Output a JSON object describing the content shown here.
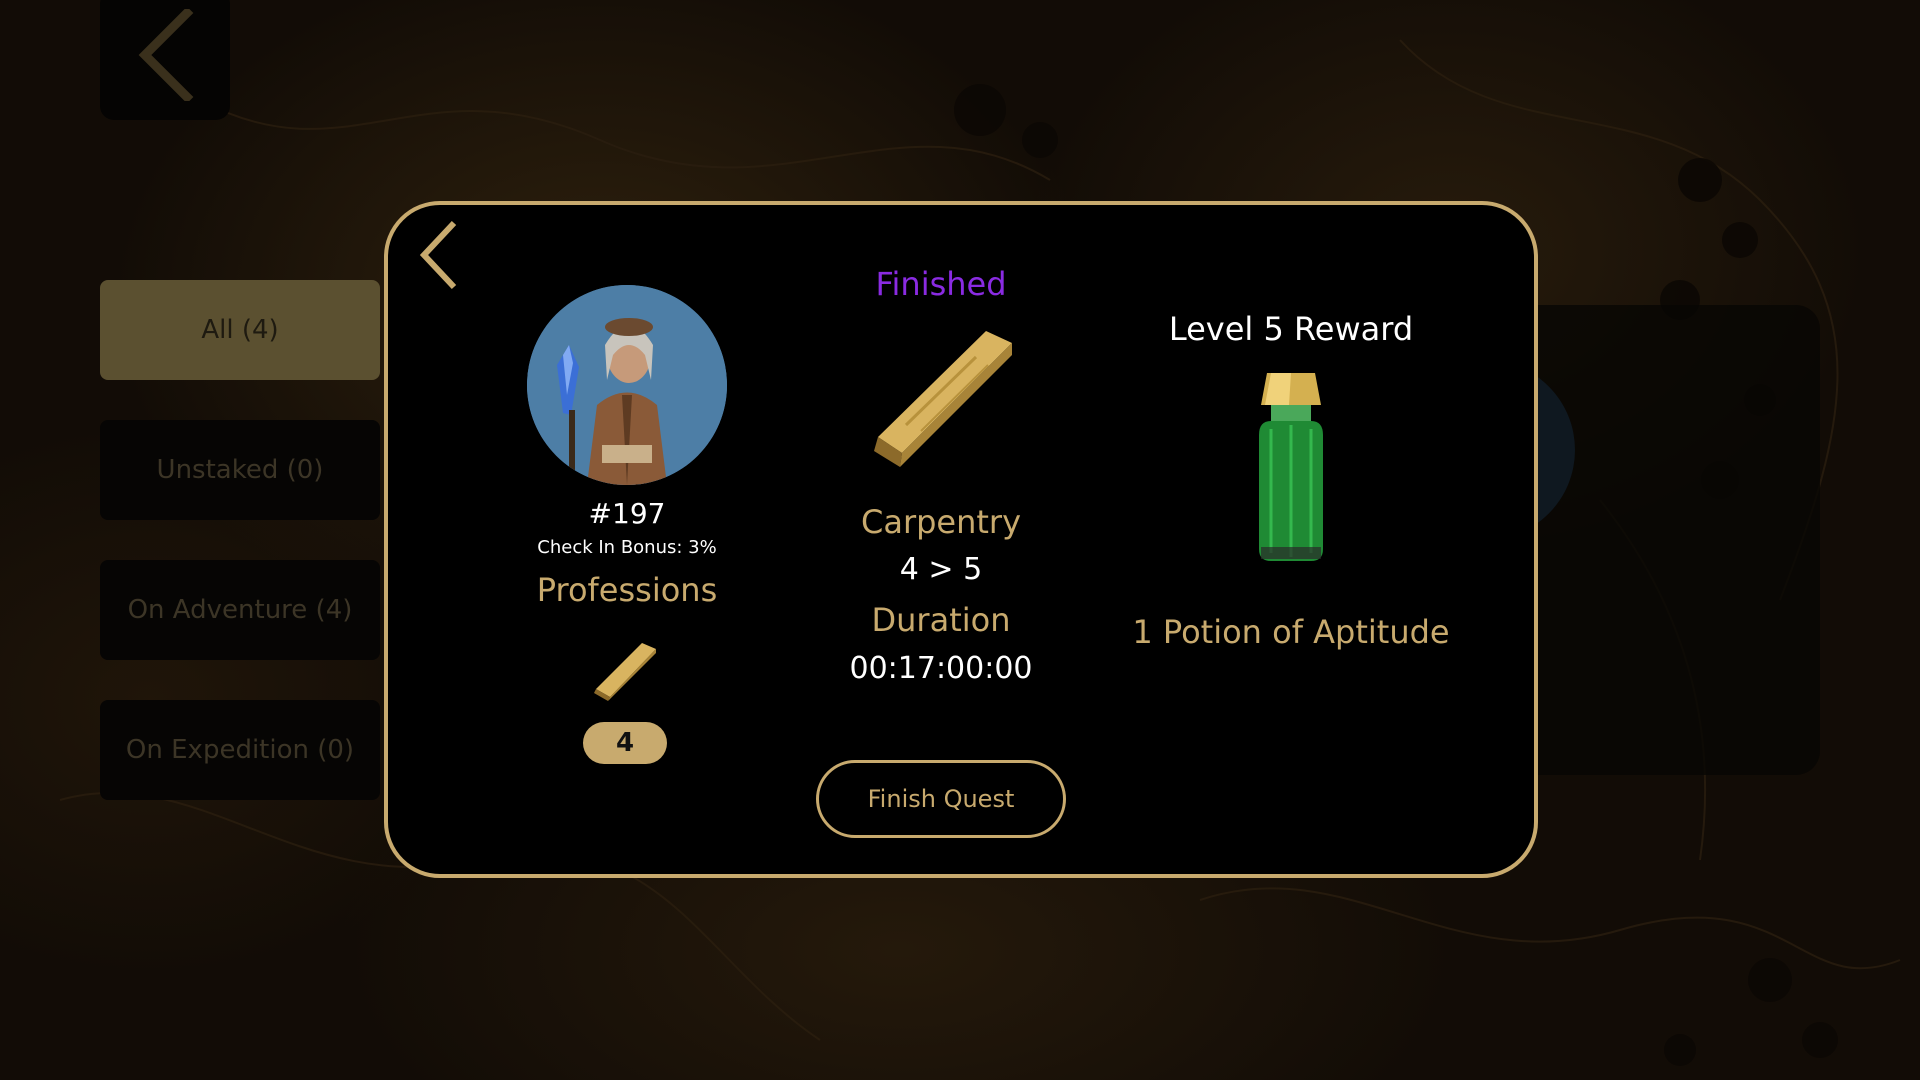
{
  "filters": {
    "all": "All (4)",
    "unstaked": "Unstaked (0)",
    "on_adventure": "On Adventure (4)",
    "on_expedition": "On Expedition (0)"
  },
  "hero": {
    "id": "#197",
    "check_in_bonus": "Check In Bonus: 3%",
    "professions_label": "Professions",
    "profession_level": "4"
  },
  "quest": {
    "status": "Finished",
    "profession": "Carpentry",
    "level_change": "4 > 5",
    "duration_label": "Duration",
    "duration": "00:17:00:00",
    "finish_label": "Finish Quest"
  },
  "reward": {
    "title": "Level 5 Reward",
    "item": "1 Potion of Aptitude"
  },
  "colors": {
    "gold": "#c8aa6e",
    "status_purple": "#8a2be2",
    "active_filter": "#5b5030"
  },
  "icons": [
    "chevron-left-icon",
    "wood-plank-icon",
    "potion-bottle-icon"
  ]
}
